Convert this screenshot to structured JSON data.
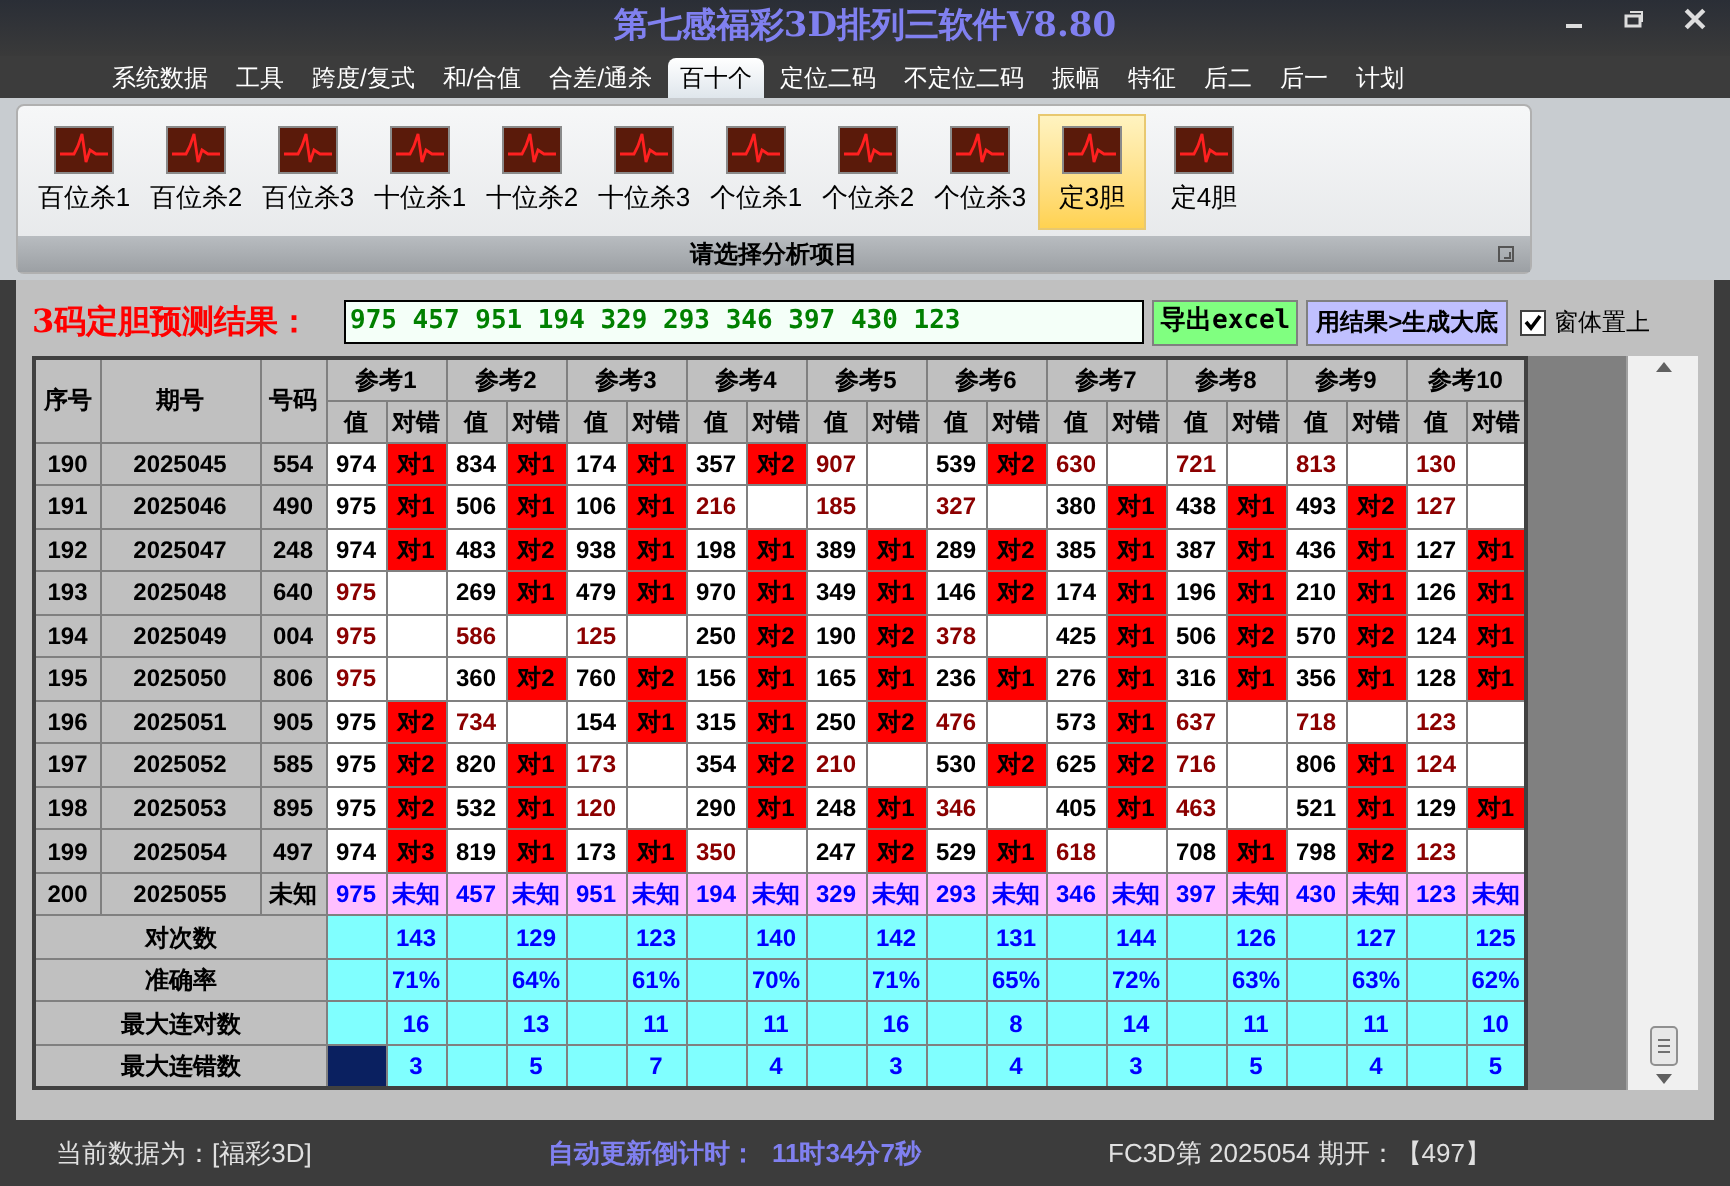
{
  "window": {
    "title": "第七感福彩3D排列三软件V8.80"
  },
  "menu": [
    {
      "label": "系统数据",
      "selected": false
    },
    {
      "label": "工具",
      "selected": false
    },
    {
      "label": "跨度/复式",
      "selected": false
    },
    {
      "label": "和/合值",
      "selected": false
    },
    {
      "label": "合差/通杀",
      "selected": false
    },
    {
      "label": "百十个",
      "selected": true
    },
    {
      "label": "定位二码",
      "selected": false
    },
    {
      "label": "不定位二码",
      "selected": false
    },
    {
      "label": "振幅",
      "selected": false
    },
    {
      "label": "特征",
      "selected": false
    },
    {
      "label": "后二",
      "selected": false
    },
    {
      "label": "后一",
      "selected": false
    },
    {
      "label": "计划",
      "selected": false
    }
  ],
  "ribbon": {
    "items": [
      {
        "label": "百位杀1",
        "selected": false
      },
      {
        "label": "百位杀2",
        "selected": false
      },
      {
        "label": "百位杀3",
        "selected": false
      },
      {
        "label": "十位杀1",
        "selected": false
      },
      {
        "label": "十位杀2",
        "selected": false
      },
      {
        "label": "十位杀3",
        "selected": false
      },
      {
        "label": "个位杀1",
        "selected": false
      },
      {
        "label": "个位杀2",
        "selected": false
      },
      {
        "label": "个位杀3",
        "selected": false
      },
      {
        "label": "定3胆",
        "selected": true
      },
      {
        "label": "定4胆",
        "selected": false
      }
    ],
    "caption": "请选择分析项目"
  },
  "prediction": {
    "label": "3码定胆预测结果：",
    "value": "975 457 951 194 329 293 346 397 430 123",
    "export_button": "导出excel",
    "generate_button": "用结果>生成大底",
    "stay_on_top": {
      "label": "窗体置上",
      "checked": true
    }
  },
  "table": {
    "columns": [
      "序号",
      "期号",
      "号码"
    ],
    "refs": [
      {
        "label": "参考1",
        "sub_columns": [
          "值",
          "对错"
        ]
      },
      {
        "label": "参考2",
        "sub_columns": [
          "值",
          "对错"
        ]
      },
      {
        "label": "参考3",
        "sub_columns": [
          "值",
          "对错"
        ]
      },
      {
        "label": "参考4",
        "sub_columns": [
          "值",
          "对错"
        ]
      },
      {
        "label": "参考5",
        "sub_columns": [
          "值",
          "对错"
        ]
      },
      {
        "label": "参考6",
        "sub_columns": [
          "值",
          "对错"
        ]
      },
      {
        "label": "参考7",
        "sub_columns": [
          "值",
          "对错"
        ]
      },
      {
        "label": "参考8",
        "sub_columns": [
          "值",
          "对错"
        ]
      },
      {
        "label": "参考9",
        "sub_columns": [
          "值",
          "对错"
        ]
      },
      {
        "label": "参考10",
        "sub_columns": [
          "值",
          "对错"
        ]
      }
    ],
    "rows": [
      {
        "kind": "history",
        "no": "190",
        "period": "2025045",
        "number": "554",
        "refs": [
          {
            "value": "974",
            "hit": true,
            "result": "对1"
          },
          {
            "value": "834",
            "hit": true,
            "result": "对1"
          },
          {
            "value": "174",
            "hit": true,
            "result": "对1"
          },
          {
            "value": "357",
            "hit": true,
            "result": "对2"
          },
          {
            "value": "907",
            "hit": false
          },
          {
            "value": "539",
            "hit": true,
            "result": "对2"
          },
          {
            "value": "630",
            "hit": false
          },
          {
            "value": "721",
            "hit": false
          },
          {
            "value": "813",
            "hit": false
          },
          {
            "value": "130",
            "hit": false
          }
        ]
      },
      {
        "kind": "history",
        "no": "191",
        "period": "2025046",
        "number": "490",
        "refs": [
          {
            "value": "975",
            "hit": true,
            "result": "对1"
          },
          {
            "value": "506",
            "hit": true,
            "result": "对1"
          },
          {
            "value": "106",
            "hit": true,
            "result": "对1"
          },
          {
            "value": "216",
            "hit": false
          },
          {
            "value": "185",
            "hit": false
          },
          {
            "value": "327",
            "hit": false
          },
          {
            "value": "380",
            "hit": true,
            "result": "对1"
          },
          {
            "value": "438",
            "hit": true,
            "result": "对1"
          },
          {
            "value": "493",
            "hit": true,
            "result": "对2"
          },
          {
            "value": "127",
            "hit": false
          }
        ]
      },
      {
        "kind": "history",
        "no": "192",
        "period": "2025047",
        "number": "248",
        "refs": [
          {
            "value": "974",
            "hit": true,
            "result": "对1"
          },
          {
            "value": "483",
            "hit": true,
            "result": "对2"
          },
          {
            "value": "938",
            "hit": true,
            "result": "对1"
          },
          {
            "value": "198",
            "hit": true,
            "result": "对1"
          },
          {
            "value": "389",
            "hit": true,
            "result": "对1"
          },
          {
            "value": "289",
            "hit": true,
            "result": "对2"
          },
          {
            "value": "385",
            "hit": true,
            "result": "对1"
          },
          {
            "value": "387",
            "hit": true,
            "result": "对1"
          },
          {
            "value": "436",
            "hit": true,
            "result": "对1"
          },
          {
            "value": "127",
            "hit": true,
            "result": "对1"
          }
        ]
      },
      {
        "kind": "history",
        "no": "193",
        "period": "2025048",
        "number": "640",
        "refs": [
          {
            "value": "975",
            "hit": false
          },
          {
            "value": "269",
            "hit": true,
            "result": "对1"
          },
          {
            "value": "479",
            "hit": true,
            "result": "对1"
          },
          {
            "value": "970",
            "hit": true,
            "result": "对1"
          },
          {
            "value": "349",
            "hit": true,
            "result": "对1"
          },
          {
            "value": "146",
            "hit": true,
            "result": "对2"
          },
          {
            "value": "174",
            "hit": true,
            "result": "对1"
          },
          {
            "value": "196",
            "hit": true,
            "result": "对1"
          },
          {
            "value": "210",
            "hit": true,
            "result": "对1"
          },
          {
            "value": "126",
            "hit": true,
            "result": "对1"
          }
        ]
      },
      {
        "kind": "history",
        "no": "194",
        "period": "2025049",
        "number": "004",
        "refs": [
          {
            "value": "975",
            "hit": false
          },
          {
            "value": "586",
            "hit": false
          },
          {
            "value": "125",
            "hit": false
          },
          {
            "value": "250",
            "hit": true,
            "result": "对2"
          },
          {
            "value": "190",
            "hit": true,
            "result": "对2"
          },
          {
            "value": "378",
            "hit": false
          },
          {
            "value": "425",
            "hit": true,
            "result": "对1"
          },
          {
            "value": "506",
            "hit": true,
            "result": "对2"
          },
          {
            "value": "570",
            "hit": true,
            "result": "对2"
          },
          {
            "value": "124",
            "hit": true,
            "result": "对1"
          }
        ]
      },
      {
        "kind": "history",
        "no": "195",
        "period": "2025050",
        "number": "806",
        "refs": [
          {
            "value": "975",
            "hit": false
          },
          {
            "value": "360",
            "hit": true,
            "result": "对2"
          },
          {
            "value": "760",
            "hit": true,
            "result": "对2"
          },
          {
            "value": "156",
            "hit": true,
            "result": "对1"
          },
          {
            "value": "165",
            "hit": true,
            "result": "对1"
          },
          {
            "value": "236",
            "hit": true,
            "result": "对1"
          },
          {
            "value": "276",
            "hit": true,
            "result": "对1"
          },
          {
            "value": "316",
            "hit": true,
            "result": "对1"
          },
          {
            "value": "356",
            "hit": true,
            "result": "对1"
          },
          {
            "value": "128",
            "hit": true,
            "result": "对1"
          }
        ]
      },
      {
        "kind": "history",
        "no": "196",
        "period": "2025051",
        "number": "905",
        "refs": [
          {
            "value": "975",
            "hit": true,
            "result": "对2"
          },
          {
            "value": "734",
            "hit": false
          },
          {
            "value": "154",
            "hit": true,
            "result": "对1"
          },
          {
            "value": "315",
            "hit": true,
            "result": "对1"
          },
          {
            "value": "250",
            "hit": true,
            "result": "对2"
          },
          {
            "value": "476",
            "hit": false
          },
          {
            "value": "573",
            "hit": true,
            "result": "对1"
          },
          {
            "value": "637",
            "hit": false
          },
          {
            "value": "718",
            "hit": false
          },
          {
            "value": "123",
            "hit": false
          }
        ]
      },
      {
        "kind": "history",
        "no": "197",
        "period": "2025052",
        "number": "585",
        "refs": [
          {
            "value": "975",
            "hit": true,
            "result": "对2"
          },
          {
            "value": "820",
            "hit": true,
            "result": "对1"
          },
          {
            "value": "173",
            "hit": false
          },
          {
            "value": "354",
            "hit": true,
            "result": "对2"
          },
          {
            "value": "210",
            "hit": false
          },
          {
            "value": "530",
            "hit": true,
            "result": "对2"
          },
          {
            "value": "625",
            "hit": true,
            "result": "对2"
          },
          {
            "value": "716",
            "hit": false
          },
          {
            "value": "806",
            "hit": true,
            "result": "对1"
          },
          {
            "value": "124",
            "hit": false
          }
        ]
      },
      {
        "kind": "history",
        "no": "198",
        "period": "2025053",
        "number": "895",
        "refs": [
          {
            "value": "975",
            "hit": true,
            "result": "对2"
          },
          {
            "value": "532",
            "hit": true,
            "result": "对1"
          },
          {
            "value": "120",
            "hit": false
          },
          {
            "value": "290",
            "hit": true,
            "result": "对1"
          },
          {
            "value": "248",
            "hit": true,
            "result": "对1"
          },
          {
            "value": "346",
            "hit": false
          },
          {
            "value": "405",
            "hit": true,
            "result": "对1"
          },
          {
            "value": "463",
            "hit": false
          },
          {
            "value": "521",
            "hit": true,
            "result": "对1"
          },
          {
            "value": "129",
            "hit": true,
            "result": "对1"
          }
        ]
      },
      {
        "kind": "history",
        "no": "199",
        "period": "2025054",
        "number": "497",
        "refs": [
          {
            "value": "974",
            "hit": true,
            "result": "对3"
          },
          {
            "value": "819",
            "hit": true,
            "result": "对1"
          },
          {
            "value": "173",
            "hit": true,
            "result": "对1"
          },
          {
            "value": "350",
            "hit": false
          },
          {
            "value": "247",
            "hit": true,
            "result": "对2"
          },
          {
            "value": "529",
            "hit": true,
            "result": "对1"
          },
          {
            "value": "618",
            "hit": false
          },
          {
            "value": "708",
            "hit": true,
            "result": "对1"
          },
          {
            "value": "798",
            "hit": true,
            "result": "对2"
          },
          {
            "value": "123",
            "hit": false
          }
        ]
      },
      {
        "kind": "forecast",
        "no": "200",
        "period": "2025055",
        "number": "未知",
        "refs": [
          {
            "value": "975",
            "result": "未知"
          },
          {
            "value": "457",
            "result": "未知"
          },
          {
            "value": "951",
            "result": "未知"
          },
          {
            "value": "194",
            "result": "未知"
          },
          {
            "value": "329",
            "result": "未知"
          },
          {
            "value": "293",
            "result": "未知"
          },
          {
            "value": "346",
            "result": "未知"
          },
          {
            "value": "397",
            "result": "未知"
          },
          {
            "value": "430",
            "result": "未知"
          },
          {
            "value": "123",
            "result": "未知"
          }
        ]
      }
    ],
    "stats": [
      {
        "label": "对次数",
        "values": [
          "143",
          "129",
          "123",
          "140",
          "142",
          "131",
          "144",
          "126",
          "127",
          "125"
        ],
        "focused": false
      },
      {
        "label": "准确率",
        "values": [
          "71%",
          "64%",
          "61%",
          "70%",
          "71%",
          "65%",
          "72%",
          "63%",
          "63%",
          "62%"
        ],
        "focused": false
      },
      {
        "label": "最大连对数",
        "values": [
          "16",
          "13",
          "11",
          "11",
          "16",
          "8",
          "14",
          "11",
          "11",
          "10"
        ],
        "focused": false
      },
      {
        "label": "最大连错数",
        "values": [
          "3",
          "5",
          "7",
          "4",
          "3",
          "4",
          "3",
          "5",
          "4",
          "5"
        ],
        "focused": true
      }
    ]
  },
  "status_bar": {
    "data_source": "当前数据为：[福彩3D]",
    "countdown_label": "自动更新倒计时：",
    "countdown": "11时34分7秒",
    "latest": "FC3D第 2025054 期开：【497】"
  }
}
